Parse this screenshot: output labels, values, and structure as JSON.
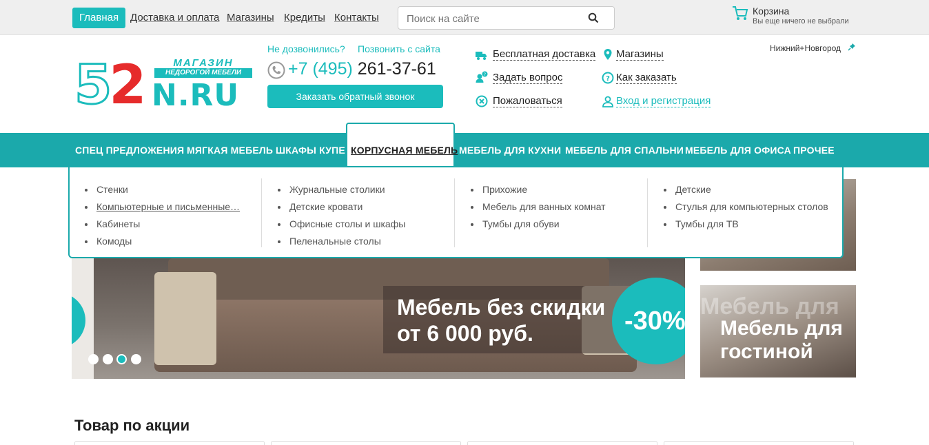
{
  "topbar": {
    "home": "Главная",
    "links": [
      "Доставка и оплата",
      "Магазины",
      "Кредиты",
      "Контакты"
    ],
    "search_placeholder": "Поиск на сайте",
    "cart_title": "Корзина",
    "cart_subtitle": "Вы еще ничего не выбрали"
  },
  "logo": {
    "digits_5": "5",
    "digits_2": "2",
    "shop": "МАГАЗИН",
    "cheap_furniture": "НЕДОРОГОЙ МЕБЕЛИ",
    "domain": "N.RU"
  },
  "header": {
    "call_question": "Не дозвонились?",
    "call_site": "Позвонить с сайта",
    "phone_code": "+7 (495)",
    "phone_number": "261-37-61",
    "callback_button": "Заказать обратный звонок",
    "links": {
      "free_delivery": "Бесплатная доставка",
      "stores": "Магазины",
      "ask_question": "Задать вопрос",
      "how_to_order": "Как заказать",
      "complain": "Пожаловаться",
      "login": "Вход и регистрация"
    },
    "city": "Нижний+Новгород"
  },
  "mainnav": [
    "СПЕЦ ПРЕДЛОЖЕНИЯ",
    "МЯГКАЯ МЕБЕЛЬ",
    "ШКАФЫ КУПЕ",
    "КОРПУСНАЯ МЕБЕЛЬ",
    "МЕБЕЛЬ ДЛЯ КУХНИ",
    "МЕБЕЛЬ ДЛЯ СПАЛЬНИ",
    "МЕБЕЛЬ ДЛЯ ОФИСА",
    "ПРОЧЕЕ"
  ],
  "dropdown": {
    "col1": [
      "Стенки",
      "Компьютерные и письменные…",
      "Кабинеты",
      "Комоды"
    ],
    "col2": [
      "Журнальные столики",
      "Детские кровати",
      "Офисные столы и шкафы",
      "Пеленальные столы"
    ],
    "col3": [
      "Прихожие",
      "Мебель для ванных комнат",
      "Тумбы для обуви"
    ],
    "col4": [
      "Детские",
      "Стулья для компьютерных столов",
      "Тумбы для ТВ"
    ]
  },
  "banner": {
    "line1": "Мебель без скидки",
    "line2": "от 6 000 руб.",
    "discount": "-30%"
  },
  "tile2": {
    "line1": "Мебель для",
    "line2": "гостиной",
    "ghost": "Мебель для"
  },
  "section_title": "Товар по акции",
  "colors": {
    "accent": "#1bbcbc",
    "nav": "#1ba9ab",
    "logo_red": "#e62b2b"
  }
}
